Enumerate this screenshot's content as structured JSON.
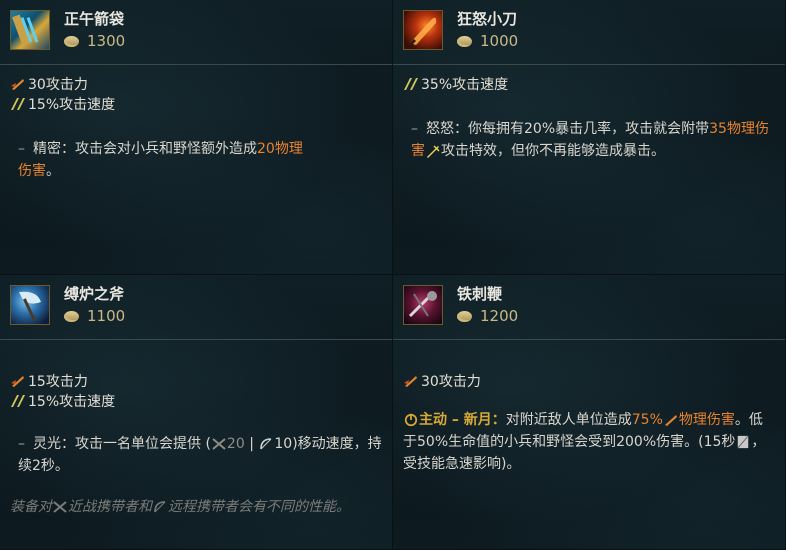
{
  "items": [
    {
      "name": "正午箭袋",
      "price": "1300",
      "stats": [
        "30攻击力",
        "15%攻击速度"
      ],
      "passive": {
        "dash": "–",
        "label": "精密：",
        "text1": "攻击会对小兵和野怪额外造成",
        "highlight": "20物理",
        "text2": "伤害",
        "end": "。"
      }
    },
    {
      "name": "狂怒小刀",
      "price": "1000",
      "stats": [
        "35%攻击速度"
      ],
      "passive": {
        "dash": "–",
        "label": "怒怒：",
        "text1": "你每拥有20%暴击几率，攻击就会附带",
        "highlight": "35物理伤害",
        "text2": "攻击特效，但你不再能够造成暴击",
        "end": "。"
      }
    },
    {
      "name": "缚炉之斧",
      "price": "1100",
      "stats": [
        "15攻击力",
        "15%攻击速度"
      ],
      "passive": {
        "dash": "–",
        "label": "灵光：",
        "text1": "攻击一名单位会提供 (",
        "melee_value": "20",
        "sep": " | ",
        "ranged_value": "10)",
        "text2": "移动速度，持续2秒",
        "end": "。"
      },
      "note": {
        "p1": "装备对",
        "p2": "近战携带者和",
        "p3": "远程携带者会有不同的性能",
        "end": "。"
      }
    },
    {
      "name": "铁刺鞭",
      "price": "1200",
      "stats": [
        "30攻击力"
      ],
      "active": {
        "label": "主动 – 新月：",
        "text1": "对附近敌人单位造成",
        "pct": "75%",
        "highlight": "物理伤害",
        "text2": "。低于50%生命值的小兵和野怪会受到200%伤害。(15秒",
        "text3": "，受技能急速影响)",
        "end": "。"
      }
    }
  ],
  "colors": {
    "orange": "#e8832d",
    "gold": "#d7a936",
    "price": "#c9b98a"
  },
  "icons": {
    "attack_damage": "sword-slash-icon",
    "attack_speed": "speed-chevron-icon",
    "gold": "gold-coin-icon",
    "melee": "crossed-swords-icon",
    "ranged": "bow-icon",
    "active": "power-icon",
    "cooldown": "hourglass-icon"
  }
}
